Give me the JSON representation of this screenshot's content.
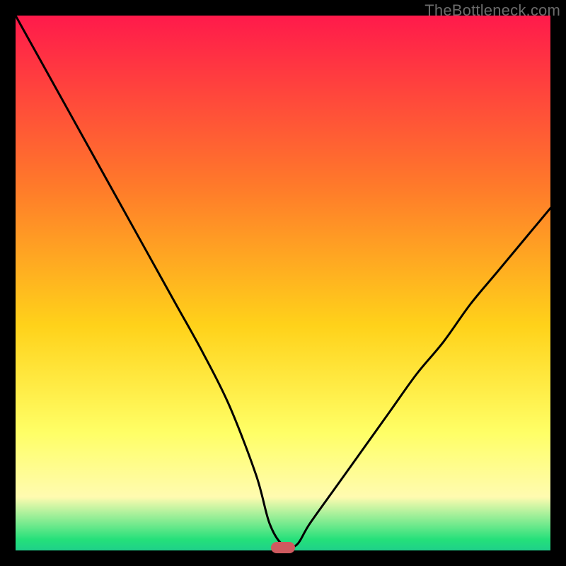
{
  "watermark": {
    "text": "TheBottleneck.com"
  },
  "colors": {
    "top": "#ff1a4b",
    "mid1": "#ff7a2a",
    "mid2": "#ffd21a",
    "mid3": "#ffff66",
    "band": "#fffbb0",
    "green": "#24e07a",
    "green2": "#1fd089",
    "curve": "#000000",
    "marker": "#cf5a5f"
  },
  "chart_data": {
    "type": "line",
    "title": "",
    "xlabel": "",
    "ylabel": "",
    "x": [
      0.0,
      0.05,
      0.1,
      0.15,
      0.2,
      0.25,
      0.3,
      0.35,
      0.4,
      0.45,
      0.475,
      0.5,
      0.525,
      0.55,
      0.6,
      0.65,
      0.7,
      0.75,
      0.8,
      0.85,
      0.9,
      0.95,
      1.0
    ],
    "values": [
      100,
      91,
      82,
      73,
      64,
      55,
      46,
      37,
      27,
      14,
      5,
      1,
      1,
      5,
      12,
      19,
      26,
      33,
      39,
      46,
      52,
      58,
      64
    ],
    "xlim": [
      0,
      1
    ],
    "ylim": [
      0,
      100
    ],
    "marker": {
      "x": 0.5,
      "y": 0
    },
    "annotations": []
  }
}
